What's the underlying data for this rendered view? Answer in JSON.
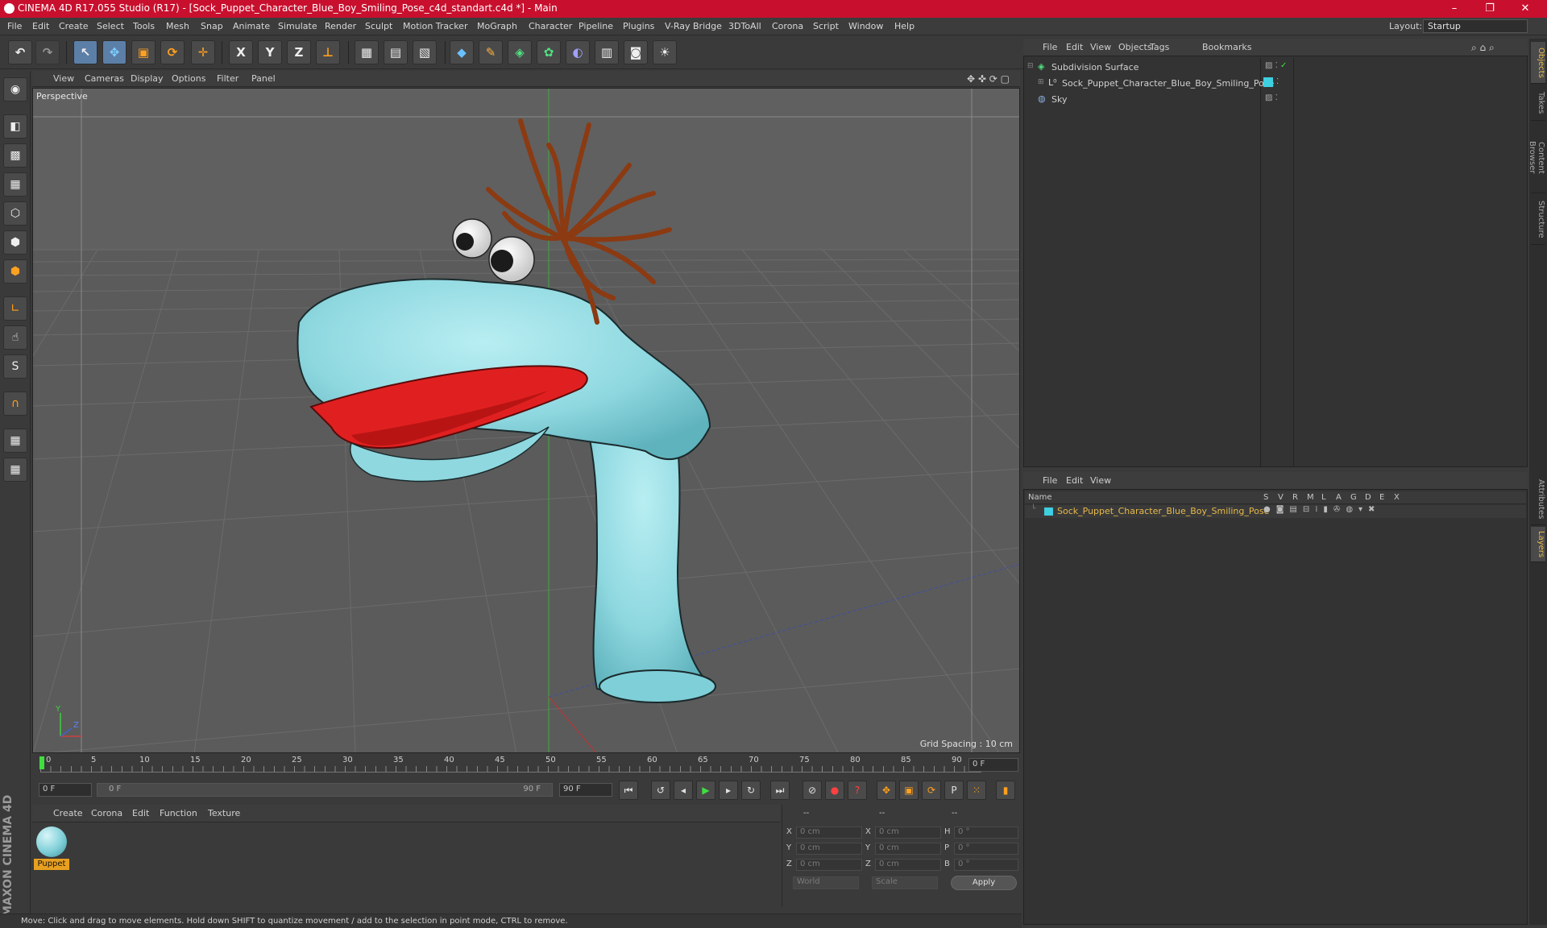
{
  "window": {
    "title": "CINEMA 4D R17.055 Studio (R17) - [Sock_Puppet_Character_Blue_Boy_Smiling_Pose_c4d_standart.c4d *] - Main",
    "minimize": "–",
    "maximize": "❐",
    "close": "✕"
  },
  "menu": [
    "File",
    "Edit",
    "Create",
    "Select",
    "Tools",
    "Mesh",
    "Snap",
    "Animate",
    "Simulate",
    "Render",
    "Sculpt",
    "Motion Tracker",
    "MoGraph",
    "Character",
    "Pipeline",
    "Plugins",
    "V-Ray Bridge",
    "3DToAll",
    "Corona",
    "Script",
    "Window",
    "Help"
  ],
  "layout": {
    "label": "Layout:",
    "value": "Startup"
  },
  "toolbar": {
    "undo": "↶",
    "redo": "↷",
    "select": "↖",
    "move": "✥",
    "scale": "▣",
    "rotate": "⟳",
    "coord": "✛",
    "x": "X",
    "y": "Y",
    "z": "Z",
    "world": "⊥"
  },
  "viewport": {
    "menu": [
      "View",
      "Cameras",
      "Display",
      "Options",
      "Filter",
      "Panel"
    ],
    "label": "Perspective",
    "grid_spacing": "Grid Spacing : 10 cm"
  },
  "timeline": {
    "ticks": [
      "0",
      "5",
      "10",
      "15",
      "20",
      "25",
      "30",
      "35",
      "40",
      "45",
      "50",
      "55",
      "60",
      "65",
      "70",
      "75",
      "80",
      "85",
      "90"
    ],
    "current_frame": "0 F",
    "start": "0 F",
    "range_start": "0 F",
    "range_end": "90 F",
    "end": "90 F"
  },
  "material": {
    "menu": [
      "Create",
      "Corona",
      "Edit",
      "Function",
      "Texture"
    ],
    "items": [
      {
        "name": "Puppet"
      }
    ]
  },
  "coordinates": {
    "header": [
      "--",
      "--",
      "--"
    ],
    "rows": [
      {
        "l1": "X",
        "v1": "0 cm",
        "l2": "X",
        "v2": "0 cm",
        "l3": "H",
        "v3": "0 °"
      },
      {
        "l1": "Y",
        "v1": "0 cm",
        "l2": "Y",
        "v2": "0 cm",
        "l3": "P",
        "v3": "0 °"
      },
      {
        "l1": "Z",
        "v1": "0 cm",
        "l2": "Z",
        "v2": "0 cm",
        "l3": "B",
        "v3": "0 °"
      }
    ],
    "mode1": "World",
    "mode2": "Scale",
    "apply": "Apply"
  },
  "status": "Move: Click and drag to move elements. Hold down SHIFT to quantize movement / add to the selection in point mode, CTRL to remove.",
  "objects": {
    "menu": [
      "File",
      "Edit",
      "View",
      "Objects",
      "Tags",
      "Bookmarks"
    ],
    "rows": [
      {
        "name": "Subdivision Surface"
      },
      {
        "name": "Sock_Puppet_Character_Blue_Boy_Smiling_Pose"
      },
      {
        "name": "Sky"
      }
    ]
  },
  "layers": {
    "menu": [
      "File",
      "Edit",
      "View"
    ],
    "header": {
      "name": "Name",
      "cols": [
        "S",
        "V",
        "R",
        "M",
        "L",
        "A",
        "G",
        "D",
        "E",
        "X"
      ]
    },
    "rows": [
      {
        "name": "Sock_Puppet_Character_Blue_Boy_Smiling_Pose"
      }
    ]
  },
  "side_tabs": [
    "Objects",
    "Takes",
    "Content Browser",
    "Structure",
    "Attributes",
    "Layers"
  ],
  "brand": "MAXON CINEMA 4D",
  "colors": {
    "title_bar": "#c8102e",
    "accent": "#e8b94a",
    "layer_color": "#3ecfe0",
    "puppet": "#8fd8e0",
    "mouth": "#e02020",
    "hair": "#8b3a12"
  }
}
